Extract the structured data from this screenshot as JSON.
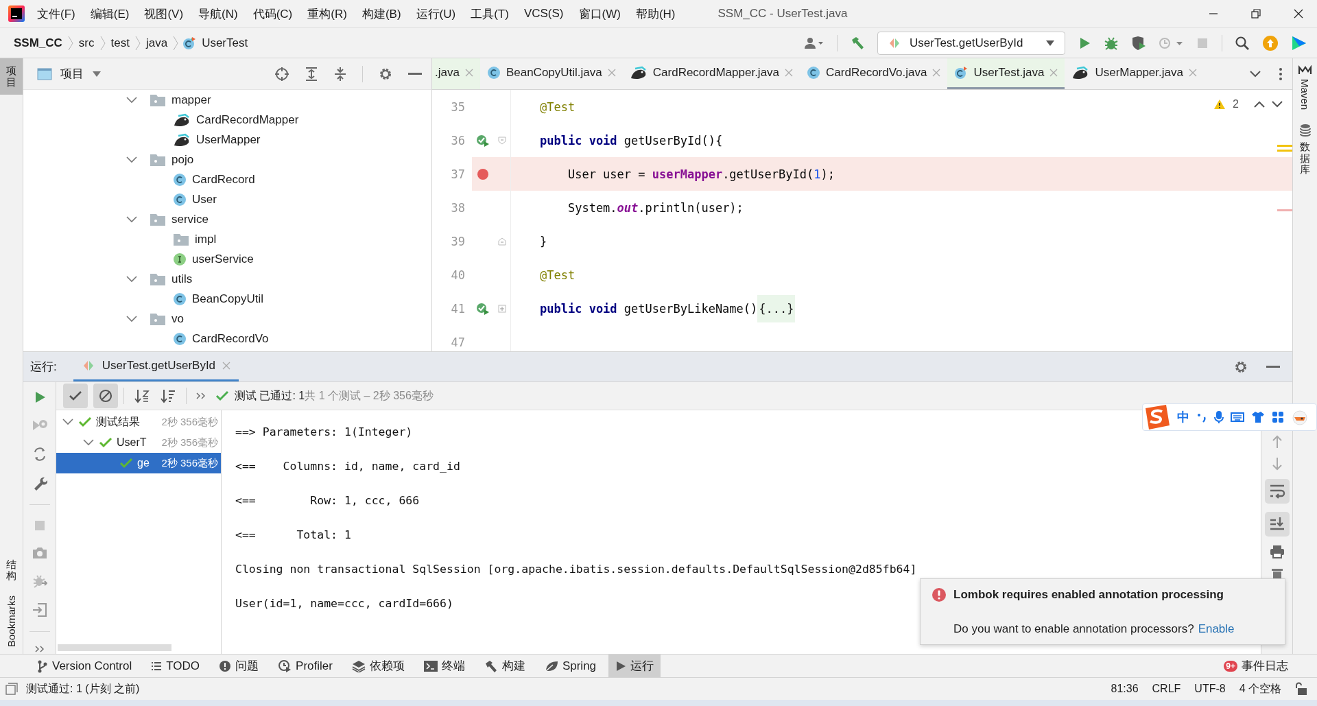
{
  "window": {
    "title": "SSM_CC - UserTest.java"
  },
  "menu": [
    "文件(F)",
    "编辑(E)",
    "视图(V)",
    "导航(N)",
    "代码(C)",
    "重构(R)",
    "构建(B)",
    "运行(U)",
    "工具(T)",
    "VCS(S)",
    "窗口(W)",
    "帮助(H)"
  ],
  "navigation": {
    "breadcrumb": [
      {
        "label": "SSM_CC",
        "kind": "project"
      },
      {
        "label": "src",
        "kind": "dir"
      },
      {
        "label": "test",
        "kind": "dir"
      },
      {
        "label": "java",
        "kind": "dir"
      },
      {
        "label": "UserTest",
        "kind": "test-class"
      }
    ],
    "run_configuration": "UserTest.getUserById"
  },
  "left_stripe": [
    {
      "label": "项目",
      "kind": "cjk",
      "selected": true
    },
    {
      "label": "结构",
      "kind": "cjk",
      "selected": false
    },
    {
      "label": "Bookmarks",
      "kind": "latin",
      "selected": false
    }
  ],
  "right_stripe": [
    {
      "label": "Maven",
      "kind": "latin"
    },
    {
      "label": "数据库",
      "kind": "cjk"
    }
  ],
  "project_panel": {
    "title": "项目",
    "tree": [
      {
        "label": "mapper",
        "kind": "folder",
        "expanded": true,
        "children": [
          {
            "label": "CardRecordMapper",
            "kind": "mapper"
          },
          {
            "label": "UserMapper",
            "kind": "mapper"
          }
        ]
      },
      {
        "label": "pojo",
        "kind": "folder",
        "expanded": true,
        "children": [
          {
            "label": "CardRecord",
            "kind": "class"
          },
          {
            "label": "User",
            "kind": "class"
          }
        ]
      },
      {
        "label": "service",
        "kind": "folder",
        "expanded": true,
        "children": [
          {
            "label": "impl",
            "kind": "folder"
          },
          {
            "label": "userService",
            "kind": "interface"
          }
        ]
      },
      {
        "label": "utils",
        "kind": "folder",
        "expanded": true,
        "children": [
          {
            "label": "BeanCopyUtil",
            "kind": "class"
          }
        ]
      },
      {
        "label": "vo",
        "kind": "folder",
        "expanded": true,
        "children": [
          {
            "label": "CardRecordVo",
            "kind": "class"
          }
        ]
      }
    ]
  },
  "editor": {
    "tabs": [
      {
        "label": ".java",
        "kind": "partial",
        "selected": false
      },
      {
        "label": "BeanCopyUtil.java",
        "kind": "class",
        "selected": false
      },
      {
        "label": "CardRecordMapper.java",
        "kind": "mapper",
        "selected": false
      },
      {
        "label": "CardRecordVo.java",
        "kind": "class",
        "selected": false
      },
      {
        "label": "UserTest.java",
        "kind": "test-class",
        "selected": true
      },
      {
        "label": "UserMapper.java",
        "kind": "mapper",
        "selected": false
      }
    ],
    "warnings": "2",
    "lines": [
      {
        "number": "35",
        "runnable": false,
        "breakpoint": false,
        "fold_start": false,
        "fold_end": false,
        "collapsed": false,
        "highlight": false,
        "tokens": [
          {
            "t": "@Test",
            "kind": "annotation"
          }
        ]
      },
      {
        "number": "36",
        "runnable": true,
        "breakpoint": false,
        "fold_start": true,
        "fold_end": false,
        "collapsed": false,
        "highlight": false,
        "tokens": [
          {
            "t": "public void ",
            "kind": "keyword"
          },
          {
            "t": "getUserById(){",
            "kind": "plain"
          }
        ]
      },
      {
        "number": "37",
        "runnable": false,
        "breakpoint": true,
        "fold_start": false,
        "fold_end": false,
        "collapsed": false,
        "highlight": true,
        "tokens": [
          {
            "t": "    User user = ",
            "kind": "plain"
          },
          {
            "t": "userMapper",
            "kind": "field"
          },
          {
            "t": ".getUserById(",
            "kind": "plain"
          },
          {
            "t": "1",
            "kind": "number"
          },
          {
            "t": ");",
            "kind": "plain"
          }
        ]
      },
      {
        "number": "38",
        "runnable": false,
        "breakpoint": false,
        "fold_start": false,
        "fold_end": false,
        "collapsed": false,
        "highlight": false,
        "tokens": [
          {
            "t": "    System.",
            "kind": "plain"
          },
          {
            "t": "out",
            "kind": "static"
          },
          {
            "t": ".println(user);",
            "kind": "plain"
          }
        ]
      },
      {
        "number": "39",
        "runnable": false,
        "breakpoint": false,
        "fold_start": false,
        "fold_end": true,
        "collapsed": false,
        "highlight": false,
        "tokens": [
          {
            "t": "}",
            "kind": "plain"
          }
        ]
      },
      {
        "number": "40",
        "runnable": false,
        "breakpoint": false,
        "fold_start": false,
        "fold_end": false,
        "collapsed": false,
        "highlight": false,
        "tokens": [
          {
            "t": "@Test",
            "kind": "annotation"
          }
        ]
      },
      {
        "number": "41",
        "runnable": true,
        "breakpoint": false,
        "fold_start": false,
        "fold_end": false,
        "collapsed": true,
        "highlight": false,
        "tokens": [
          {
            "t": "public void ",
            "kind": "keyword"
          },
          {
            "t": "getUserByLikeName()",
            "kind": "plain"
          },
          {
            "t": "{...}",
            "kind": "folded"
          }
        ]
      },
      {
        "number": "47",
        "runnable": false,
        "breakpoint": false,
        "fold_start": false,
        "fold_end": false,
        "collapsed": false,
        "highlight": false
      }
    ]
  },
  "run_panel": {
    "label": "运行:",
    "tabs": [
      {
        "label": "UserTest.getUserById",
        "selected": true
      }
    ],
    "filters": [
      {
        "kind": "passed",
        "on": true
      },
      {
        "kind": "ignored",
        "on": true
      }
    ],
    "status": {
      "passed": "测试 已通过: 1",
      "summary": "共 1 个测试 – 2秒 356毫秒"
    },
    "test_tree": [
      {
        "label": "测试结果",
        "time": "2秒 356毫秒",
        "expanded": true,
        "selected": false,
        "children": [
          {
            "label": "UserT",
            "time": "2秒 356毫秒",
            "expanded": true,
            "selected": false,
            "children": [
              {
                "label": "ge",
                "time": "2秒 356毫秒",
                "selected": true
              }
            ]
          }
        ]
      }
    ],
    "console": [
      "==> Parameters: 1(Integer)",
      "<==    Columns: id, name, card_id",
      "<==        Row: 1, ccc, 666",
      "<==      Total: 1",
      "Closing non transactional SqlSession [org.apache.ibatis.session.defaults.DefaultSqlSession@2d85fb64]",
      "User(id=1, name=ccc, cardId=666)"
    ]
  },
  "notification": {
    "title": "Lombok requires enabled annotation processing",
    "message": "Do you want to enable annotation processors?",
    "action": "Enable"
  },
  "tool_tabs": [
    {
      "label": "Version Control",
      "kind": "vcs",
      "selected": false
    },
    {
      "label": "TODO",
      "kind": "todo",
      "selected": false
    },
    {
      "label": "问题",
      "kind": "problems",
      "selected": false
    },
    {
      "label": "Profiler",
      "kind": "profiler",
      "selected": false
    },
    {
      "label": "依赖项",
      "kind": "dependencies",
      "selected": false
    },
    {
      "label": "终端",
      "kind": "terminal",
      "selected": false
    },
    {
      "label": "构建",
      "kind": "build",
      "selected": false
    },
    {
      "label": "Spring",
      "kind": "spring",
      "selected": false
    },
    {
      "label": "运行",
      "kind": "run",
      "selected": true
    }
  ],
  "event_log": {
    "badge": "9+",
    "label": "事件日志"
  },
  "status_bar": {
    "message": "测试通过: 1 (片刻 之前)",
    "items": [
      "81:36",
      "CRLF",
      "UTF-8",
      "4 个空格"
    ]
  },
  "ime_toolbar": {
    "mode": "中"
  }
}
